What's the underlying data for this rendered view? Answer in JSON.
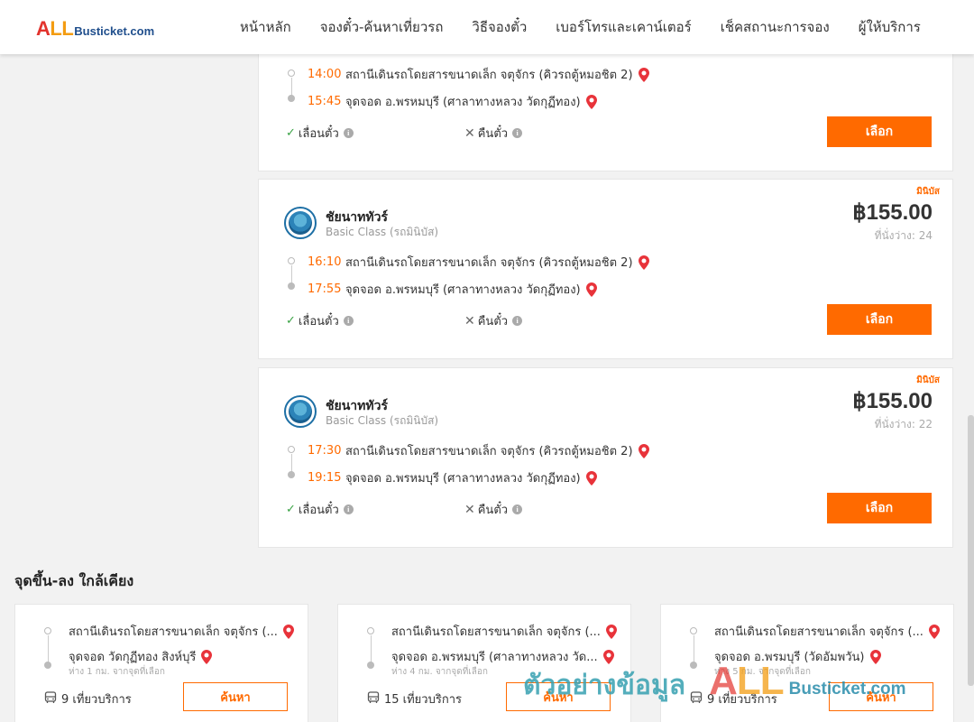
{
  "header": {
    "logo_all_a": "A",
    "logo_all_ll": "LL",
    "logo_rest": "Busticket.com",
    "nav": [
      "หน้าหลัก",
      "จองตั๋ว-ค้นหาเที่ยวรถ",
      "วิธีจองตั๋ว",
      "เบอร์โทรและเคาน์เตอร์",
      "เช็คสถานะการจอง",
      "ผู้ให้บริการ"
    ]
  },
  "trips": [
    {
      "depart_time": "14:00",
      "depart_station": "สถานีเดินรถโดยสารขนาดเล็ก จตุจักร (คิวรถตู้หมอชิต 2)",
      "arrive_time": "15:45",
      "arrive_station": "จุดจอด อ.พรหมบุรี (ศาลาทางหลวง วัดกุฏีทอง)",
      "reschedule": "เลื่อนตั๋ว",
      "refund": "คืนตั๋ว",
      "select": "เลือก"
    },
    {
      "tag": "มินิบัส",
      "company": "ชัยนาททัวร์",
      "class": "Basic Class (รถมินิบัส)",
      "price": "฿155.00",
      "seats": "ที่นั่งว่าง: 24",
      "depart_time": "16:10",
      "depart_station": "สถานีเดินรถโดยสารขนาดเล็ก จตุจักร (คิวรถตู้หมอชิต 2)",
      "arrive_time": "17:55",
      "arrive_station": "จุดจอด อ.พรหมบุรี (ศาลาทางหลวง วัดกุฏีทอง)",
      "reschedule": "เลื่อนตั๋ว",
      "refund": "คืนตั๋ว",
      "select": "เลือก"
    },
    {
      "tag": "มินิบัส",
      "company": "ชัยนาททัวร์",
      "class": "Basic Class (รถมินิบัส)",
      "price": "฿155.00",
      "seats": "ที่นั่งว่าง: 22",
      "depart_time": "17:30",
      "depart_station": "สถานีเดินรถโดยสารขนาดเล็ก จตุจักร (คิวรถตู้หมอชิต 2)",
      "arrive_time": "19:15",
      "arrive_station": "จุดจอด อ.พรหมบุรี (ศาลาทางหลวง วัดกุฏีทอง)",
      "reschedule": "เลื่อนตั๋ว",
      "refund": "คืนตั๋ว",
      "select": "เลือก"
    }
  ],
  "nearby": {
    "title": "จุดขึ้น-ลง ใกล้เคียง",
    "items": [
      {
        "from": "สถานีเดินรถโดยสารขนาดเล็ก จตุจักร (...",
        "to": "จุดจอด วัดกุฏีทอง สิงห์บุรี",
        "distance": "ห่าง 1 กม. จากจุดที่เลือก",
        "services": "9 เที่ยวบริการ",
        "search": "ค้นหา"
      },
      {
        "from": "สถานีเดินรถโดยสารขนาดเล็ก จตุจักร (...",
        "to": "จุดจอด อ.พรหมบุรี (ศาลาทางหลวง วัด...",
        "distance": "ห่าง 4 กม. จากจุดที่เลือก",
        "services": "15 เที่ยวบริการ",
        "search": "ค้นหา"
      },
      {
        "from": "สถานีเดินรถโดยสารขนาดเล็ก จตุจักร (...",
        "to": "จุดจอด อ.พรมบุรี (วัดอัมพวัน)",
        "distance": "ห่าง 5 กม. จากจุดที่เลือก",
        "services": "9 เที่ยวบริการ",
        "search": "ค้นหา"
      }
    ]
  },
  "watermark": {
    "text": "ตัวอย่างข้อมูล",
    "all_a": "A",
    "all_ll": "LL",
    "rest": "Busticket.com"
  },
  "colors": {
    "accent": "#ff6a00",
    "check": "#3aa345",
    "pin": "#e8333a"
  }
}
